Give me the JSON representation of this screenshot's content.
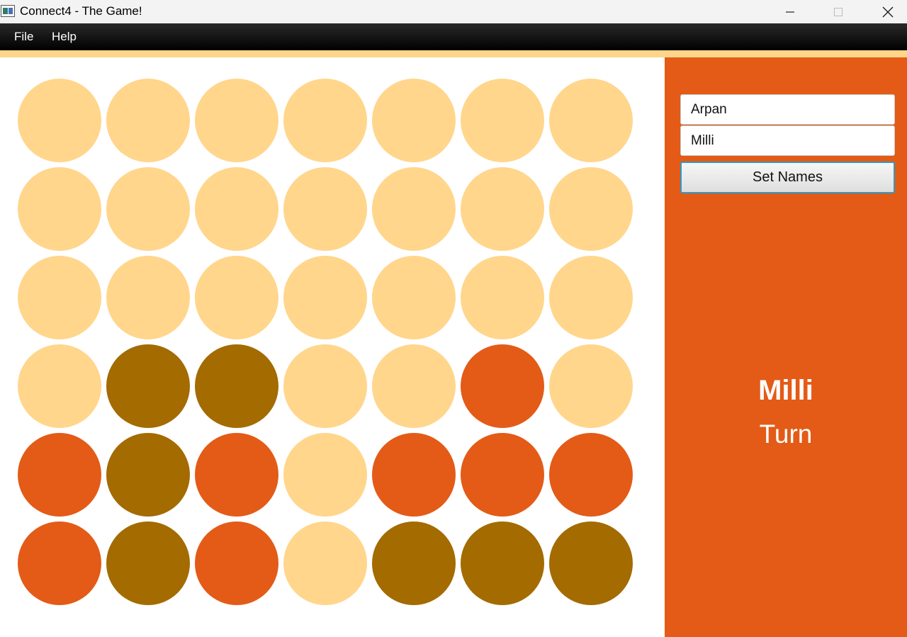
{
  "window": {
    "title": "Connect4 - The Game!",
    "icon": "app-window-icon",
    "controls": [
      "minimize-icon",
      "maximize-icon",
      "close-icon"
    ]
  },
  "menu": {
    "file_label": "File",
    "help_label": "Help"
  },
  "colors": {
    "empty": "#ffd68c",
    "player_one": "#e35b17",
    "player_two": "#a36b00",
    "panel": "#e35b17",
    "menubar": "#000000"
  },
  "board": {
    "columns": 7,
    "rows": 6,
    "cells": [
      [
        "empty",
        "empty",
        "empty",
        "empty",
        "empty",
        "empty",
        "empty"
      ],
      [
        "empty",
        "empty",
        "empty",
        "empty",
        "empty",
        "empty",
        "empty"
      ],
      [
        "empty",
        "empty",
        "empty",
        "empty",
        "empty",
        "empty",
        "empty"
      ],
      [
        "empty",
        "player_two",
        "player_two",
        "empty",
        "empty",
        "player_one",
        "empty"
      ],
      [
        "player_one",
        "player_two",
        "player_one",
        "empty",
        "player_one",
        "player_one",
        "player_one"
      ],
      [
        "player_one",
        "player_two",
        "player_one",
        "empty",
        "player_two",
        "player_two",
        "player_two"
      ]
    ]
  },
  "players": {
    "player_one_name": "Arpan",
    "player_two_name": "Milli"
  },
  "set_names_label": "Set Names",
  "turn": {
    "name": "Milli",
    "label": "Turn"
  }
}
